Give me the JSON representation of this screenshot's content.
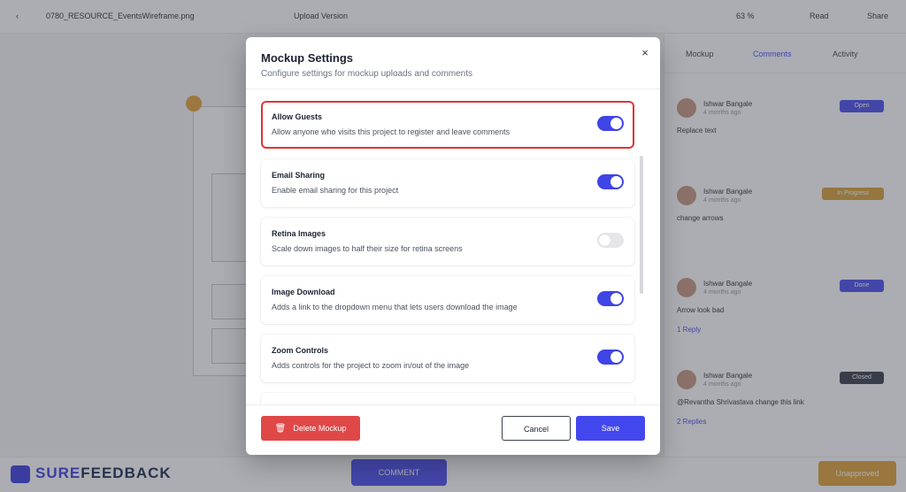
{
  "background": {
    "file_name": "0780_RESOURCE_EventsWireframe.png",
    "upload_label": "Upload Version",
    "zoom": "63 %",
    "read_label": "Read",
    "share_label": "Share",
    "tabs": [
      "Mockup",
      "Comments",
      "Activity"
    ],
    "comments": [
      {
        "name": "Ishwar Bangale",
        "time": "4 months ago",
        "badge": "Open",
        "badge_color": "#4c4ef0",
        "text": "Replace text",
        "foot": ""
      },
      {
        "name": "Ishwar Bangale",
        "time": "4 months ago",
        "badge": "In Progress",
        "badge_color": "#d9a13a",
        "text": "change arrows",
        "foot": ""
      },
      {
        "name": "Ishwar Bangale",
        "time": "4 months ago",
        "badge": "Done",
        "badge_color": "#4c4ef0",
        "text": "Arrow look bad",
        "foot": "1 Reply"
      },
      {
        "name": "Ishwar Bangale",
        "time": "4 months ago",
        "badge": "Closed",
        "badge_color": "#3a3f4a",
        "text": "@Revantha Shrivastava change this link",
        "foot": "2 Replies"
      }
    ],
    "logo_part1": "SURE",
    "logo_part2": "FEEDBACK",
    "comment_button": "COMMENT",
    "approve_button": "Unapproved"
  },
  "modal": {
    "title": "Mockup Settings",
    "subtitle": "Configure settings for mockup uploads and comments",
    "close_label": "×",
    "settings": [
      {
        "title": "Allow Guests",
        "description": "Allow anyone who visits this project to register and leave comments",
        "enabled": true
      },
      {
        "title": "Email Sharing",
        "description": "Enable email sharing for this project",
        "enabled": true
      },
      {
        "title": "Retina Images",
        "description": "Scale down images to half their size for retina screens",
        "enabled": false
      },
      {
        "title": "Image Download",
        "description": "Adds a link to the dropdown menu that lets users download the image",
        "enabled": true
      },
      {
        "title": "Zoom Controls",
        "description": "Adds controls for the project to zoom in/out of the image",
        "enabled": true
      }
    ],
    "delete_label": "Delete Mockup",
    "cancel_label": "Cancel",
    "save_label": "Save"
  },
  "colors": {
    "accent": "#4347ee",
    "danger": "#e04848",
    "highlight": "#e03434"
  }
}
